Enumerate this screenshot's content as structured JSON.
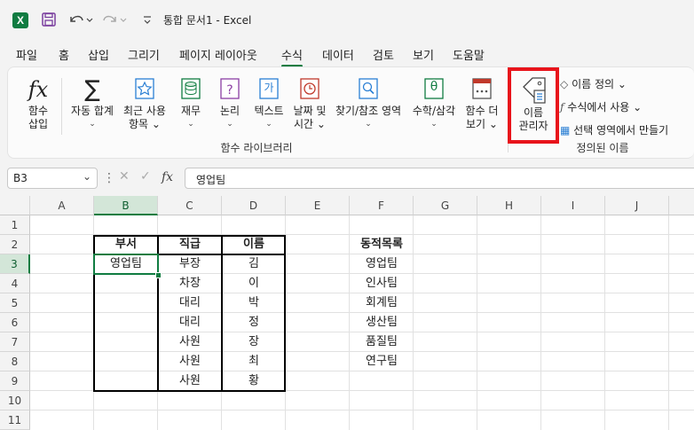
{
  "window": {
    "app_logo": "X",
    "doc_title": "통합 문서1  -  Excel"
  },
  "quick_access": {
    "save_icon": "save-icon",
    "undo_icon": "undo-icon",
    "redo_icon": "redo-icon",
    "more_icon": "customize-icon"
  },
  "tabs": [
    "파일",
    "홈",
    "삽입",
    "그리기",
    "페이지 레이아웃",
    "수식",
    "데이터",
    "검토",
    "보기",
    "도움말"
  ],
  "active_tab": "수식",
  "ribbon": {
    "insert_function": {
      "l1": "함수",
      "l2": "삽입"
    },
    "autosum": {
      "l1": "자동 합계",
      "l2": "⌄"
    },
    "recent": {
      "l1": "최근 사용",
      "l2": "항목 ⌄"
    },
    "financial": {
      "l1": "재무",
      "l2": "⌄"
    },
    "logical": {
      "l1": "논리",
      "l2": "⌄"
    },
    "text": {
      "l1": "텍스트",
      "l2": "⌄",
      "icon_glyph": "가"
    },
    "datetime": {
      "l1": "날짜 및",
      "l2": "시간 ⌄"
    },
    "lookup": {
      "l1": "찾기/참조 영역",
      "l2": "⌄"
    },
    "math": {
      "l1": "수학/삼각",
      "l2": "⌄",
      "icon_glyph": "θ"
    },
    "more_functions": {
      "l1": "함수 더",
      "l2": "보기 ⌄"
    },
    "library_group_label": "함수 라이브러리",
    "name_manager": {
      "l1": "이름",
      "l2": "관리자"
    },
    "define_name": "이름 정의  ⌄",
    "use_in_formula": "수식에서 사용 ⌄",
    "create_from_selection": "선택 영역에서 만들기",
    "defined_names_group_label": "정의된 이름",
    "highlight_color": "#e8141b"
  },
  "formula_bar": {
    "name_box": "B3",
    "fx": "fx",
    "content": "영업팀"
  },
  "columns": [
    "A",
    "B",
    "C",
    "D",
    "E",
    "F",
    "G",
    "H",
    "I",
    "J"
  ],
  "rows": [
    "1",
    "2",
    "3",
    "4",
    "5",
    "6",
    "7",
    "8",
    "9",
    "10",
    "11"
  ],
  "selected_cell": "B3",
  "table": {
    "headers": [
      "부서",
      "직급",
      "이름"
    ],
    "rows": [
      [
        "영업팀",
        "부장",
        "김"
      ],
      [
        "",
        "차장",
        "이"
      ],
      [
        "",
        "대리",
        "박"
      ],
      [
        "",
        "대리",
        "정"
      ],
      [
        "",
        "사원",
        "장"
      ],
      [
        "",
        "사원",
        "최"
      ],
      [
        "",
        "사원",
        "황"
      ]
    ]
  },
  "dynamic_list": {
    "header": "동적목록",
    "items": [
      "영업팀",
      "인사팀",
      "회계팀",
      "생산팀",
      "품질팀",
      "연구팀"
    ]
  },
  "accent_color": "#107c41"
}
